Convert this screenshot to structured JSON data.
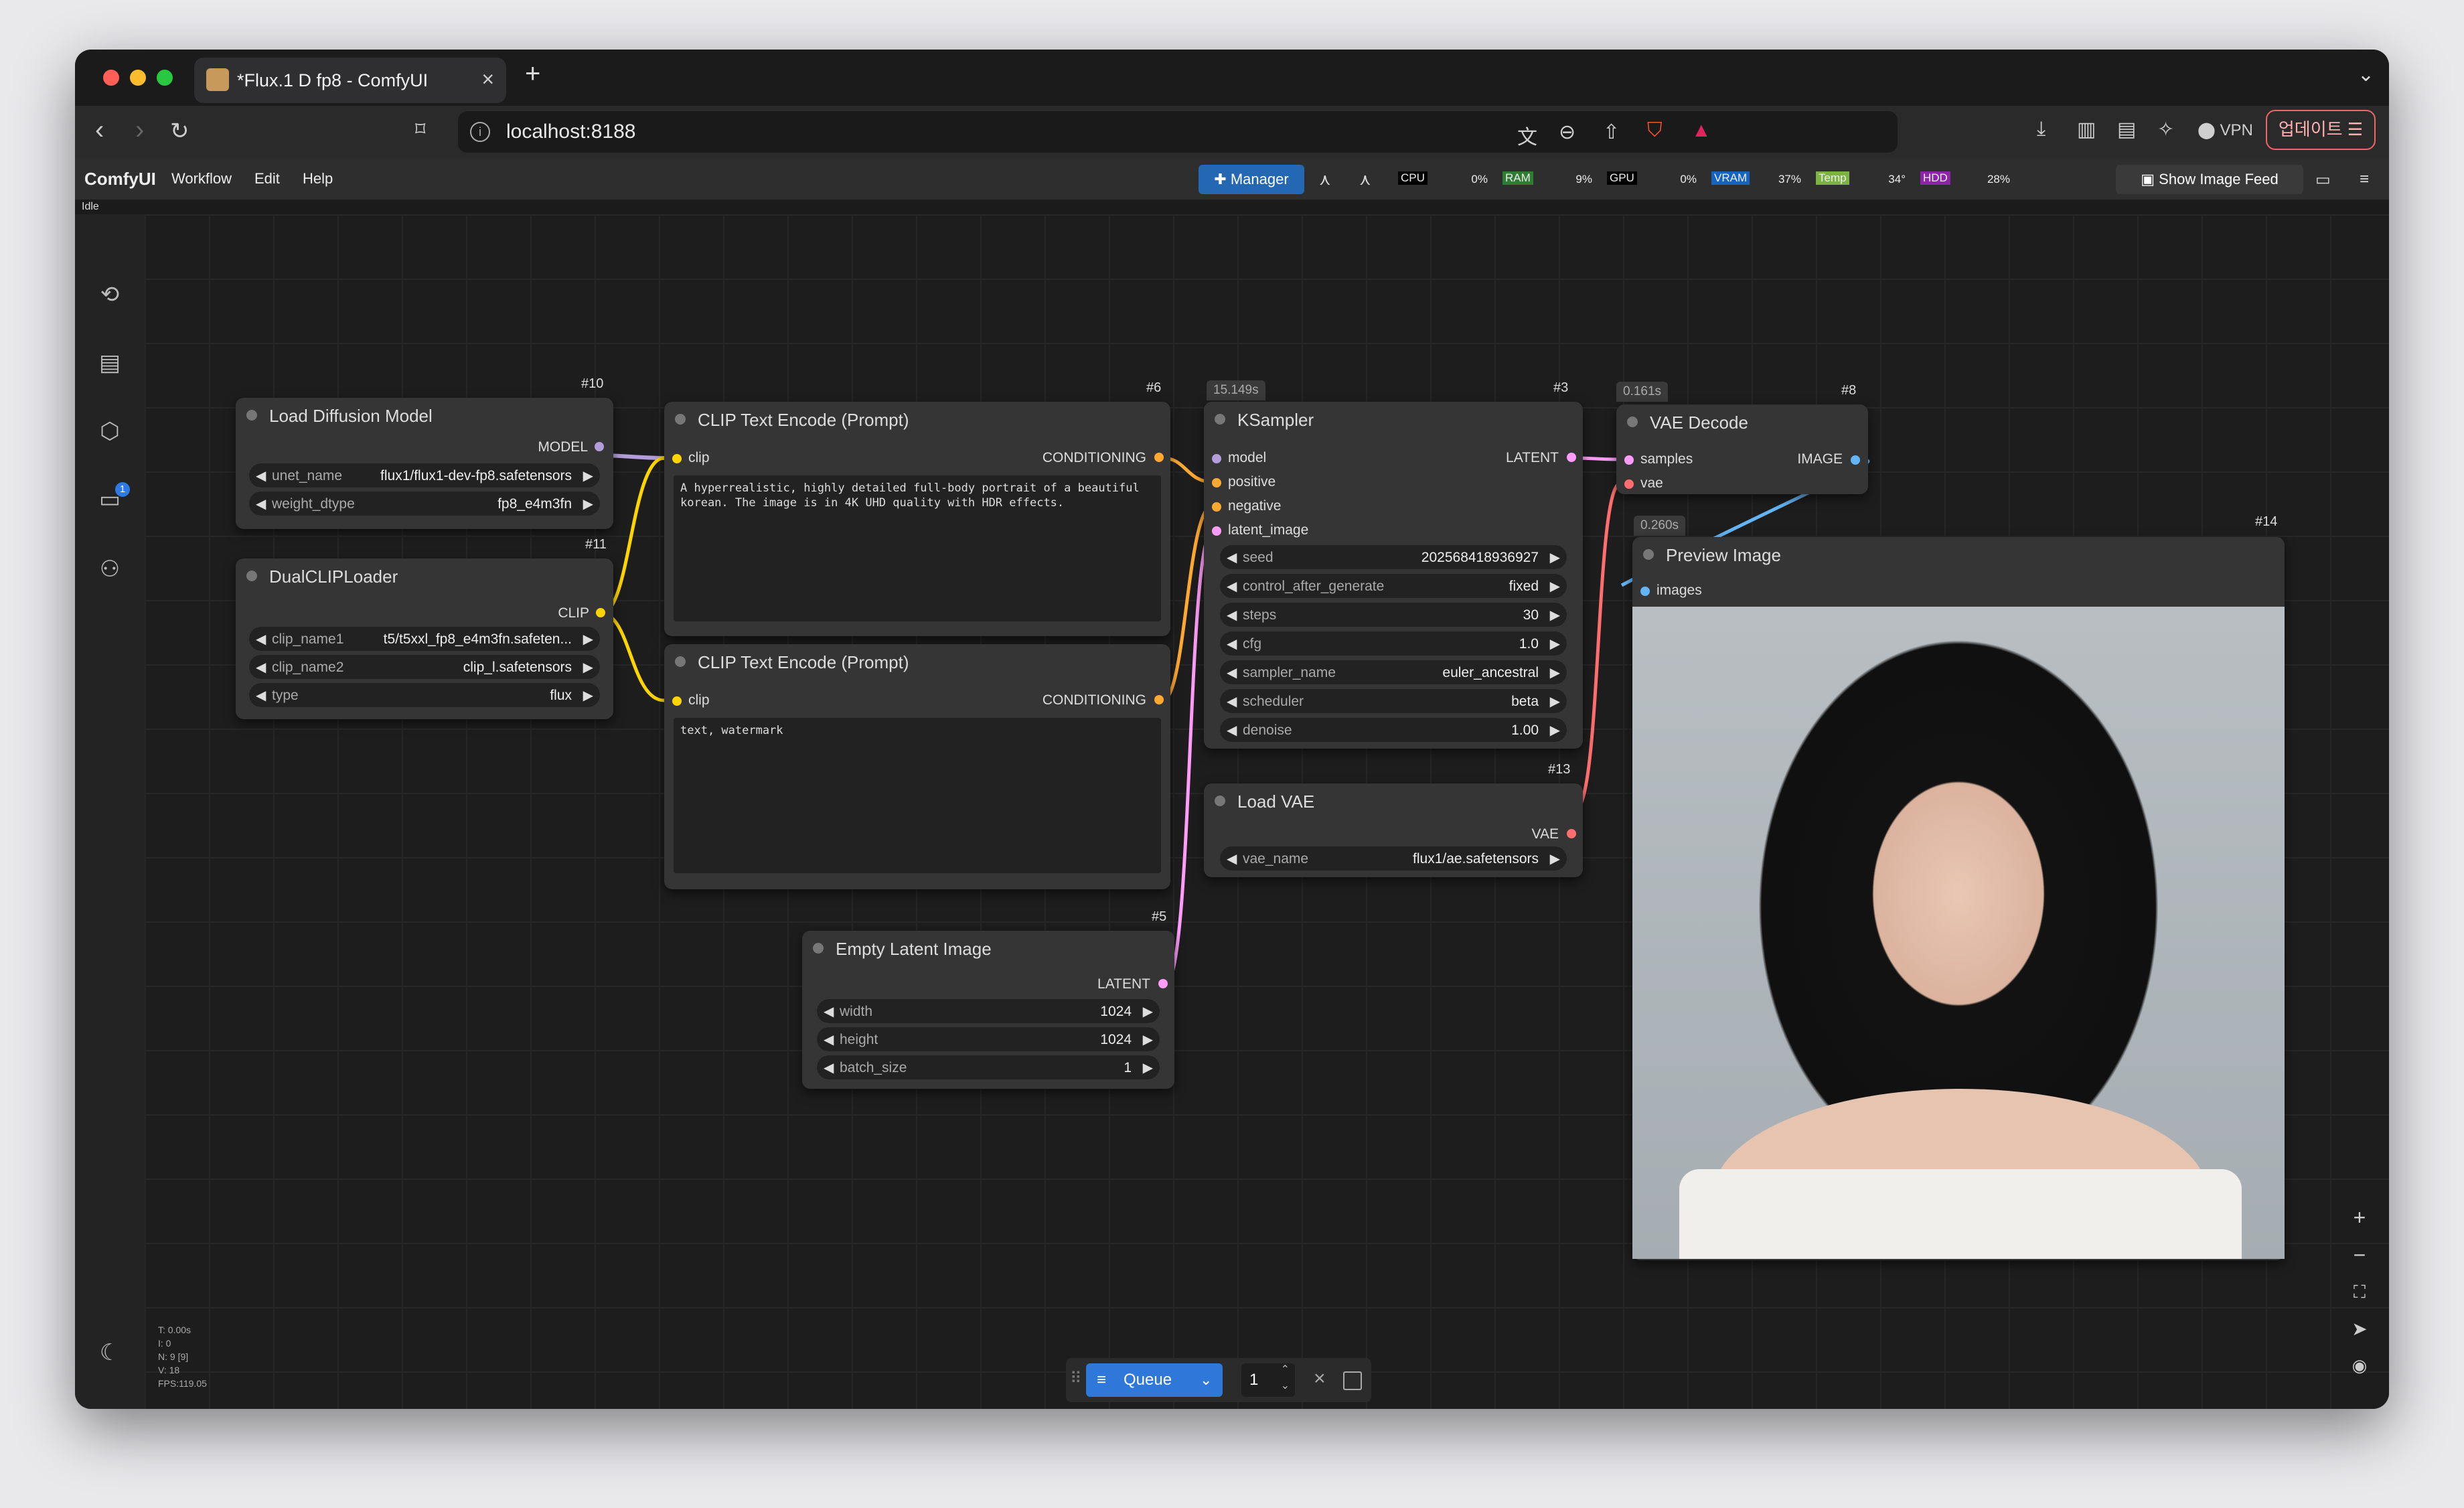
{
  "browser": {
    "tab_title": "*Flux.1 D fp8 - ComfyUI",
    "url": "localhost:8188",
    "vpn_label": "VPN",
    "update_label": "업데이트"
  },
  "menu": {
    "brand": "ComfyUI",
    "workflow": "Workflow",
    "edit": "Edit",
    "help": "Help"
  },
  "toolbar": {
    "manager_label": "Manager",
    "monitors": [
      {
        "label": "CPU",
        "value": "0%",
        "color": "#000000"
      },
      {
        "label": "RAM",
        "value": "9%",
        "color": "#2e7d32"
      },
      {
        "label": "GPU",
        "value": "0%",
        "color": "#000000"
      },
      {
        "label": "VRAM",
        "value": "37%",
        "color": "#1565c0"
      },
      {
        "label": "Temp",
        "value": "34°",
        "color": "#7cb342"
      },
      {
        "label": "HDD",
        "value": "28%",
        "color": "#8e24aa"
      }
    ],
    "image_feed_label": "Show Image Feed"
  },
  "status_text": "Idle",
  "queue_badge": "1",
  "stats": [
    "T: 0.00s",
    "I: 0",
    "N: 9 [9]",
    "V: 18",
    "FPS:119.05"
  ],
  "nodes": {
    "load_diffusion": {
      "id": "#10",
      "title": "Load Diffusion Model",
      "output": "MODEL",
      "widgets": [
        {
          "label": "unet_name",
          "value": "flux1/flux1-dev-fp8.safetensors"
        },
        {
          "label": "weight_dtype",
          "value": "fp8_e4m3fn"
        }
      ]
    },
    "dual_clip": {
      "id": "#11",
      "title": "DualCLIPLoader",
      "output": "CLIP",
      "widgets": [
        {
          "label": "clip_name1",
          "value": "t5/t5xxl_fp8_e4m3fn.safeten..."
        },
        {
          "label": "clip_name2",
          "value": "clip_l.safetensors"
        },
        {
          "label": "type",
          "value": "flux"
        }
      ]
    },
    "clip_pos": {
      "id": "#6",
      "title": "CLIP Text Encode (Prompt)",
      "input": "clip",
      "output": "CONDITIONING",
      "text": "A hyperrealistic, highly detailed full-body portrait of a beautiful korean. The image is in 4K UHD quality with HDR effects."
    },
    "clip_neg": {
      "title": "CLIP Text Encode (Prompt)",
      "input": "clip",
      "output": "CONDITIONING",
      "text": "text, watermark"
    },
    "ksampler": {
      "id": "#3",
      "time": "15.149s",
      "title": "KSampler",
      "output": "LATENT",
      "inputs": [
        "model",
        "positive",
        "negative",
        "latent_image"
      ],
      "widgets": [
        {
          "label": "seed",
          "value": "202568418936927"
        },
        {
          "label": "control_after_generate",
          "value": "fixed"
        },
        {
          "label": "steps",
          "value": "30"
        },
        {
          "label": "cfg",
          "value": "1.0"
        },
        {
          "label": "sampler_name",
          "value": "euler_ancestral"
        },
        {
          "label": "scheduler",
          "value": "beta"
        },
        {
          "label": "denoise",
          "value": "1.00"
        }
      ]
    },
    "load_vae": {
      "id": "#13",
      "title": "Load VAE",
      "output": "VAE",
      "widgets": [
        {
          "label": "vae_name",
          "value": "flux1/ae.safetensors"
        }
      ]
    },
    "empty_latent": {
      "id": "#5",
      "title": "Empty Latent Image",
      "output": "LATENT",
      "widgets": [
        {
          "label": "width",
          "value": "1024"
        },
        {
          "label": "height",
          "value": "1024"
        },
        {
          "label": "batch_size",
          "value": "1"
        }
      ]
    },
    "vae_decode": {
      "id": "#8",
      "time": "0.161s",
      "title": "VAE Decode",
      "inputs": [
        "samples",
        "vae"
      ],
      "output": "IMAGE"
    },
    "preview": {
      "id": "#14",
      "time": "0.260s",
      "title": "Preview Image",
      "input": "images"
    }
  },
  "queue": {
    "label": "Queue",
    "count": "1"
  },
  "colors": {
    "model": "#b39ddb",
    "clip": "#ffd500",
    "conditioning": "#ffa931",
    "latent": "#ff9cf9",
    "vae": "#ff6e6e",
    "image": "#64b5f6"
  }
}
